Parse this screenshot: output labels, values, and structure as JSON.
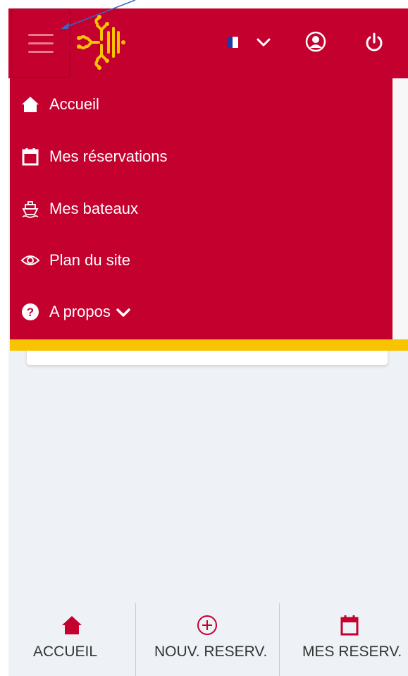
{
  "colors": {
    "brand_red": "#c4002f",
    "accent_yellow": "#f8c300",
    "page_background": "#eef1f5"
  },
  "header": {
    "menu_toggle_icon": "hamburger-icon",
    "logo_icon": "occitan-cross-logo",
    "language": {
      "flag": "french-flag-icon",
      "dropdown_icon": "chevron-down-icon"
    },
    "user_icon": "user-circle-icon",
    "logout_icon": "power-icon"
  },
  "drawer": {
    "items": [
      {
        "label": "Accueil",
        "icon": "home-icon"
      },
      {
        "label": "Mes réservations",
        "icon": "calendar-icon"
      },
      {
        "label": "Mes bateaux",
        "icon": "boat-icon"
      },
      {
        "label": "Plan du site",
        "icon": "eye-icon"
      },
      {
        "label": "A propos",
        "icon": "question-circle-icon",
        "trailing_icon": "chevron-down-icon"
      }
    ]
  },
  "bottom_nav": {
    "items": [
      {
        "label": "ACCUEIL",
        "icon": "home-icon"
      },
      {
        "label": "NOUV. RESERV.",
        "icon": "plus-circle-icon"
      },
      {
        "label": "MES RESERV.",
        "icon": "calendar-icon"
      }
    ]
  }
}
